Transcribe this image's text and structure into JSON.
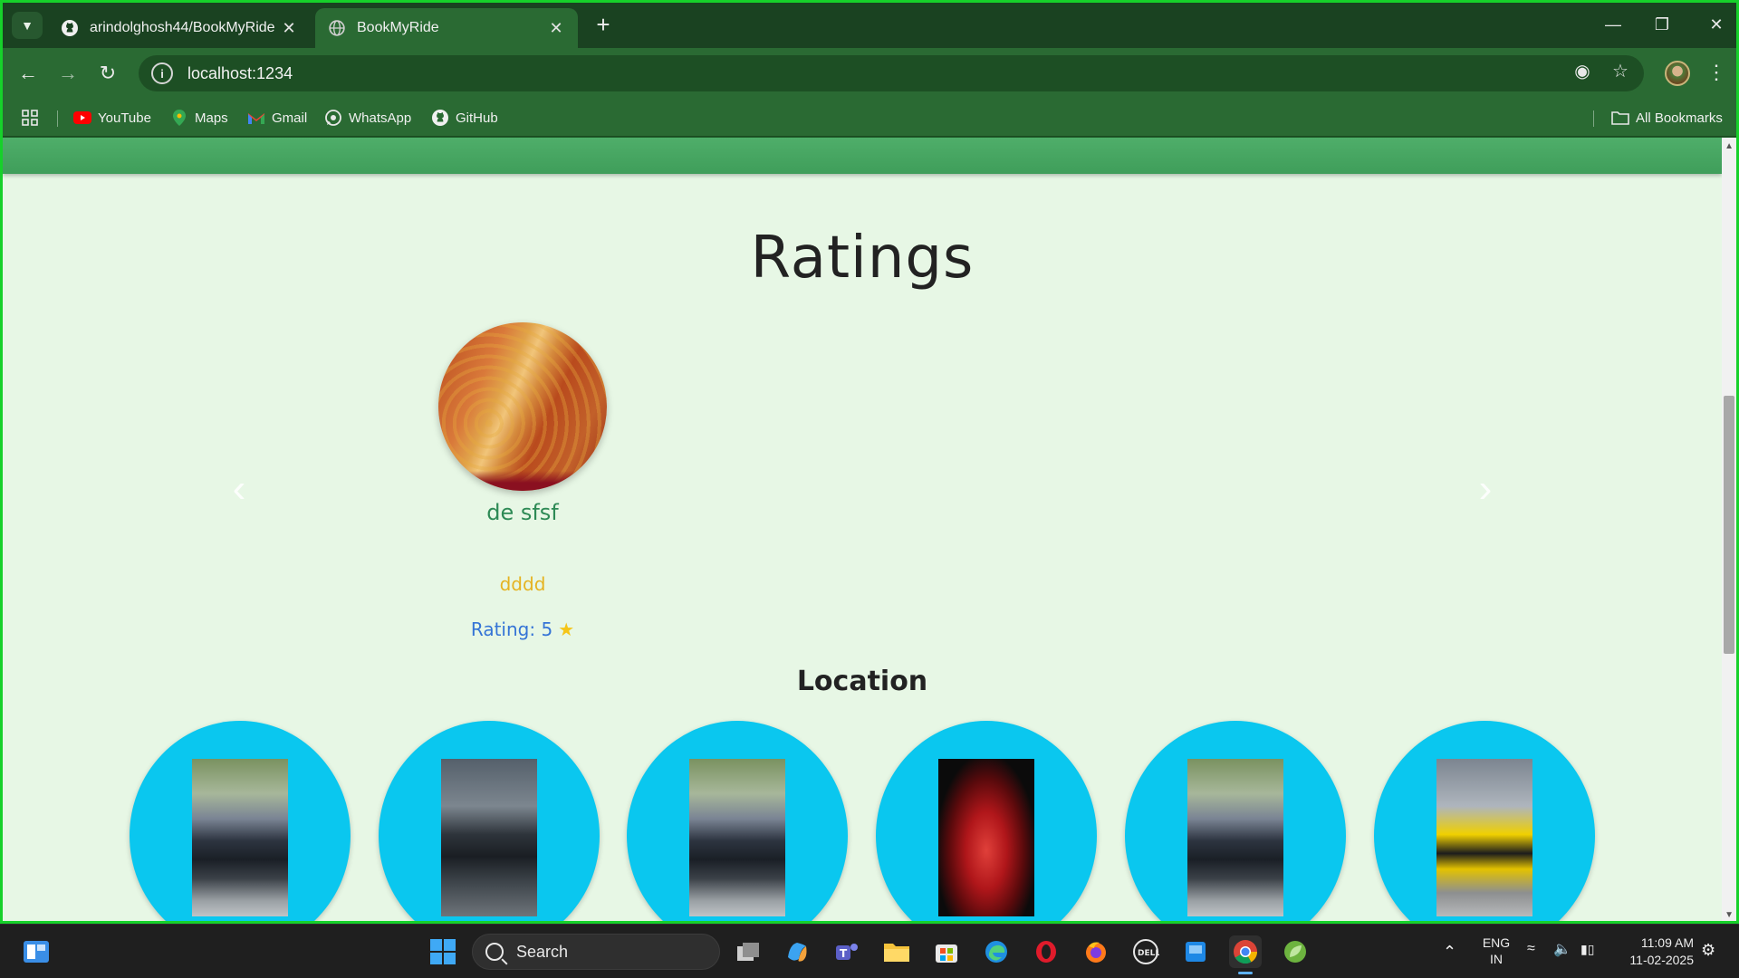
{
  "browser": {
    "tabs": [
      {
        "title": "arindolghosh44/BookMyRide",
        "active": false,
        "favicon": "github-icon"
      },
      {
        "title": "BookMyRide",
        "active": true,
        "favicon": "globe-icon"
      }
    ],
    "url": "localhost:1234",
    "bookmarks": [
      {
        "label": "YouTube",
        "icon": "youtube-icon"
      },
      {
        "label": "Maps",
        "icon": "maps-icon"
      },
      {
        "label": "Gmail",
        "icon": "gmail-icon"
      },
      {
        "label": "WhatsApp",
        "icon": "whatsapp-icon"
      },
      {
        "label": "GitHub",
        "icon": "github-icon"
      }
    ],
    "all_bookmarks_label": "All Bookmarks"
  },
  "page": {
    "ratings_heading": "Ratings",
    "review": {
      "name": "de sfsf",
      "text": "dddd",
      "rating_label": "Rating: 5",
      "rating_value": 5
    },
    "location_heading": "Location",
    "colors": {
      "background": "#e7f7e5",
      "header_strip": "#4fae6a",
      "location_circle": "#0ac7ef",
      "name": "#2d8a55",
      "review_text": "#e5b321",
      "rating": "#3574d6"
    }
  },
  "taskbar": {
    "search_label": "Search",
    "language": "ENG",
    "region": "IN",
    "time": "11:09 AM",
    "date": "11-02-2025"
  }
}
